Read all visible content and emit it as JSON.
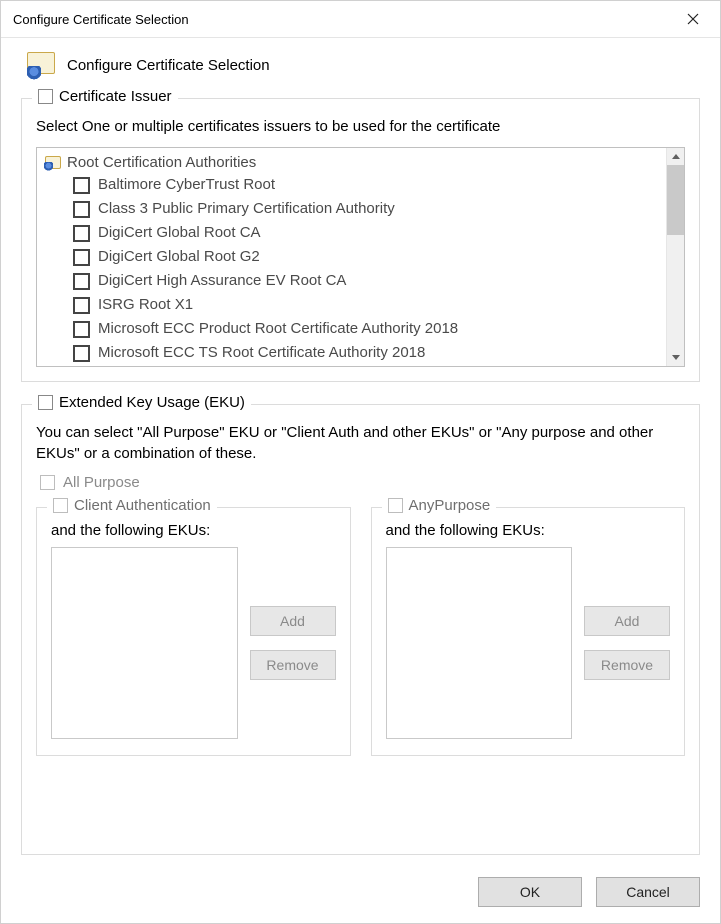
{
  "window": {
    "title": "Configure Certificate Selection"
  },
  "header": {
    "title": "Configure Certificate Selection"
  },
  "issuer": {
    "legend": "Certificate Issuer",
    "description": "Select One or multiple certificates issuers to be used for the certificate",
    "root_label": "Root Certification Authorities",
    "items": [
      "Baltimore CyberTrust Root",
      "Class 3 Public Primary Certification Authority",
      "DigiCert Global Root CA",
      "DigiCert Global Root G2",
      "DigiCert High Assurance EV Root CA",
      "ISRG Root X1",
      "Microsoft ECC Product Root Certificate Authority 2018",
      "Microsoft ECC TS Root Certificate Authority 2018"
    ]
  },
  "eku": {
    "legend": "Extended Key Usage (EKU)",
    "description": "You can select \"All Purpose\" EKU or \"Client Auth and other EKUs\" or \"Any purpose and other EKUs\" or a combination of these.",
    "all_purpose_label": "All Purpose",
    "client": {
      "legend": "Client Authentication",
      "sub_label": "and the following EKUs:",
      "add": "Add",
      "remove": "Remove"
    },
    "any": {
      "legend": "AnyPurpose",
      "sub_label": "and the following EKUs:",
      "add": "Add",
      "remove": "Remove"
    }
  },
  "buttons": {
    "ok": "OK",
    "cancel": "Cancel"
  }
}
